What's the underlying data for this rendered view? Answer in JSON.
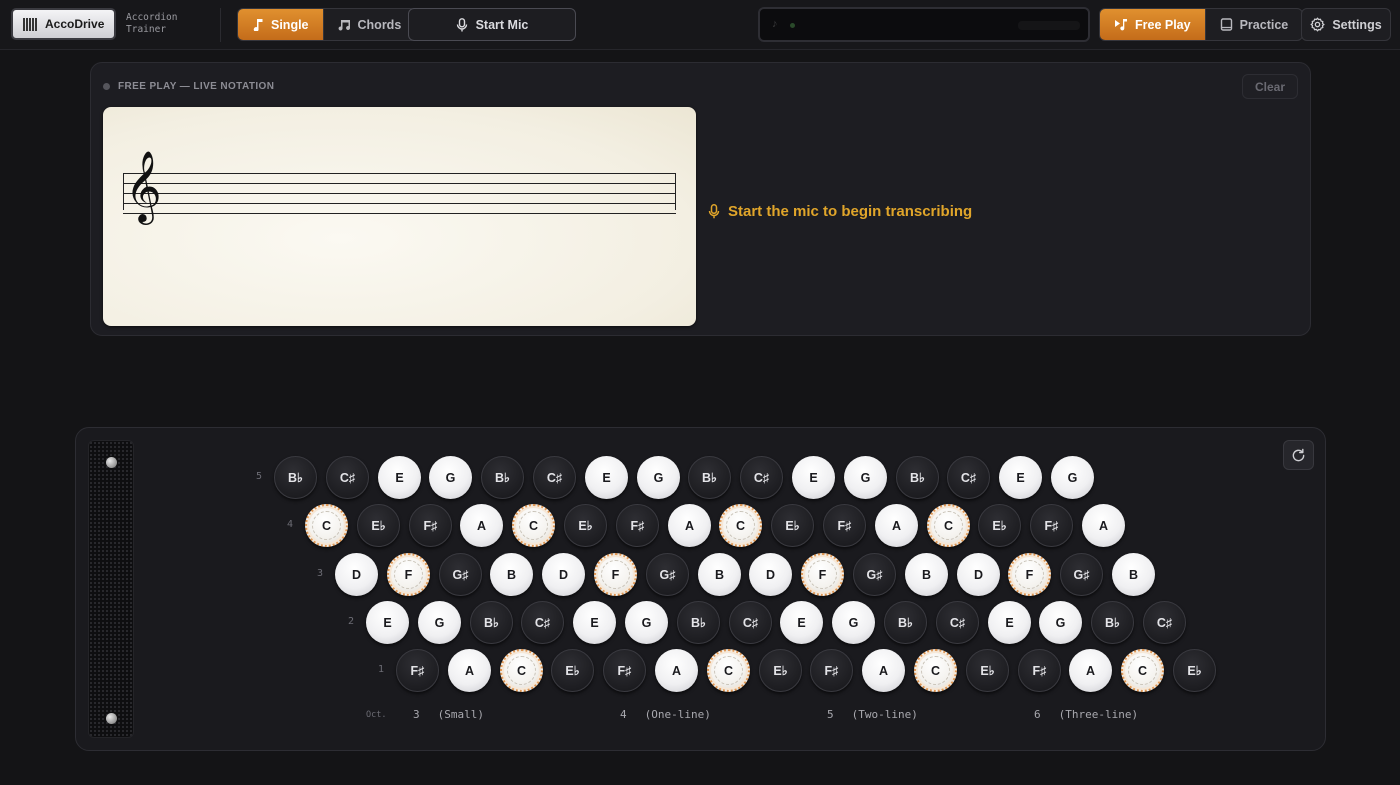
{
  "header": {
    "logo_label": "AccoDrive",
    "subtitle_line1": "Accordion",
    "subtitle_line2": "Trainer",
    "mode_single": "Single",
    "mode_chords": "Chords",
    "mic_label": "Start Mic",
    "free_play_label": "Free Play",
    "practice_label": "Practice",
    "settings_label": "Settings"
  },
  "notation": {
    "heading": "FREE PLAY — LIVE NOTATION",
    "clear_label": "Clear",
    "hint": "Start the mic to begin transcribing",
    "clef_glyph": "𝄞"
  },
  "keyboard": {
    "rows": [
      {
        "label": "5",
        "buttons": [
          [
            "B♭",
            "b"
          ],
          [
            "C♯",
            "b"
          ],
          [
            "E",
            "w"
          ],
          [
            "G",
            "w"
          ],
          [
            "B♭",
            "b"
          ],
          [
            "C♯",
            "b"
          ],
          [
            "E",
            "w"
          ],
          [
            "G",
            "w"
          ],
          [
            "B♭",
            "b"
          ],
          [
            "C♯",
            "b"
          ],
          [
            "E",
            "w"
          ],
          [
            "G",
            "w"
          ],
          [
            "B♭",
            "b"
          ],
          [
            "C♯",
            "b"
          ],
          [
            "E",
            "w"
          ],
          [
            "G",
            "w"
          ]
        ]
      },
      {
        "label": "4",
        "buttons": [
          [
            "C",
            "c"
          ],
          [
            "E♭",
            "b"
          ],
          [
            "F♯",
            "b"
          ],
          [
            "A",
            "w"
          ],
          [
            "C",
            "c"
          ],
          [
            "E♭",
            "b"
          ],
          [
            "F♯",
            "b"
          ],
          [
            "A",
            "w"
          ],
          [
            "C",
            "c"
          ],
          [
            "E♭",
            "b"
          ],
          [
            "F♯",
            "b"
          ],
          [
            "A",
            "w"
          ],
          [
            "C",
            "c"
          ],
          [
            "E♭",
            "b"
          ],
          [
            "F♯",
            "b"
          ],
          [
            "A",
            "w"
          ]
        ]
      },
      {
        "label": "3",
        "buttons": [
          [
            "D",
            "w"
          ],
          [
            "F",
            "c"
          ],
          [
            "G♯",
            "b"
          ],
          [
            "B",
            "w"
          ],
          [
            "D",
            "w"
          ],
          [
            "F",
            "c"
          ],
          [
            "G♯",
            "b"
          ],
          [
            "B",
            "w"
          ],
          [
            "D",
            "w"
          ],
          [
            "F",
            "c"
          ],
          [
            "G♯",
            "b"
          ],
          [
            "B",
            "w"
          ],
          [
            "D",
            "w"
          ],
          [
            "F",
            "c"
          ],
          [
            "G♯",
            "b"
          ],
          [
            "B",
            "w"
          ]
        ]
      },
      {
        "label": "2",
        "buttons": [
          [
            "E",
            "w"
          ],
          [
            "G",
            "w"
          ],
          [
            "B♭",
            "b"
          ],
          [
            "C♯",
            "b"
          ],
          [
            "E",
            "w"
          ],
          [
            "G",
            "w"
          ],
          [
            "B♭",
            "b"
          ],
          [
            "C♯",
            "b"
          ],
          [
            "E",
            "w"
          ],
          [
            "G",
            "w"
          ],
          [
            "B♭",
            "b"
          ],
          [
            "C♯",
            "b"
          ],
          [
            "E",
            "w"
          ],
          [
            "G",
            "w"
          ],
          [
            "B♭",
            "b"
          ],
          [
            "C♯",
            "b"
          ]
        ]
      },
      {
        "label": "1",
        "buttons": [
          [
            "F♯",
            "b"
          ],
          [
            "A",
            "w"
          ],
          [
            "C",
            "c"
          ],
          [
            "E♭",
            "b"
          ],
          [
            "F♯",
            "b"
          ],
          [
            "A",
            "w"
          ],
          [
            "C",
            "c"
          ],
          [
            "E♭",
            "b"
          ],
          [
            "F♯",
            "b"
          ],
          [
            "A",
            "w"
          ],
          [
            "C",
            "c"
          ],
          [
            "E♭",
            "b"
          ],
          [
            "F♯",
            "b"
          ],
          [
            "A",
            "w"
          ],
          [
            "C",
            "c"
          ],
          [
            "E♭",
            "b"
          ]
        ]
      }
    ],
    "octave_heading": "Oct.",
    "octaves": [
      {
        "num": "3",
        "name": "(Small)"
      },
      {
        "num": "4",
        "name": "(One-line)"
      },
      {
        "num": "5",
        "name": "(Two-line)"
      },
      {
        "num": "6",
        "name": "(Three-line)"
      }
    ]
  }
}
